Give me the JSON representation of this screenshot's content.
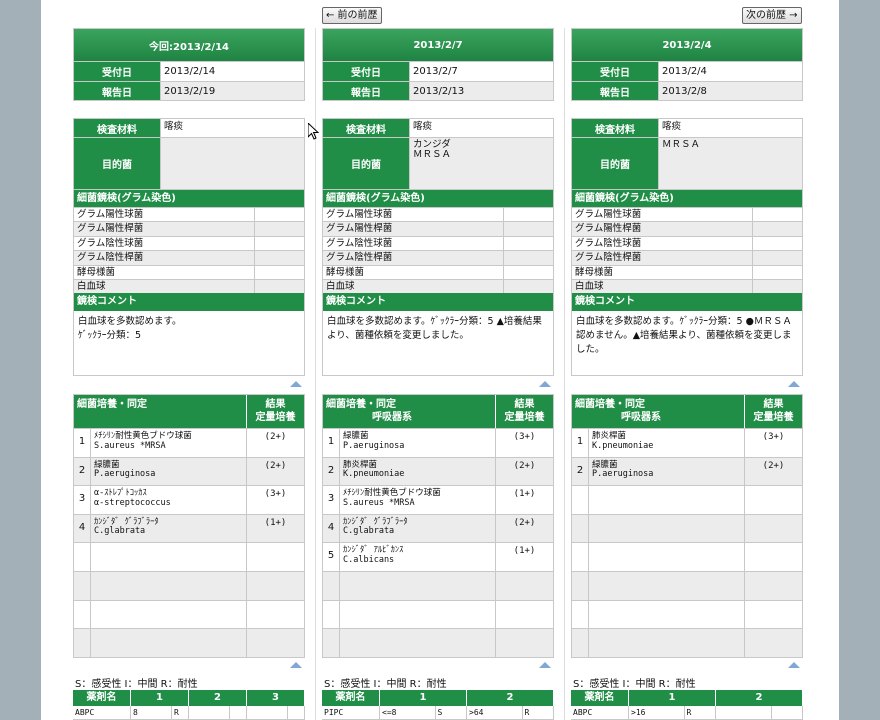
{
  "nav": {
    "prev_label": "← 前の前歴",
    "next_label": "次の前歴 →"
  },
  "labels": {
    "reception": "受付日",
    "report": "報告日",
    "material": "検査材料",
    "target": "目的菌",
    "gram_title": "細菌鏡検(グラム染色)",
    "gram_rows": [
      "グラム陽性球菌",
      "グラム陽性桿菌",
      "グラム陰性球菌",
      "グラム陰性桿菌",
      "酵母様菌",
      "白血球"
    ],
    "comment_title": "鏡検コメント",
    "culture_title": "細菌培養・同定",
    "result_label": "結果",
    "quant_label": "定量培養",
    "legend": "S：感受性  I：中間  R：耐性",
    "drug_label": "薬剤名"
  },
  "columns": [
    {
      "date_header": "今回:2013/2/14",
      "reception_date": "2013/2/14",
      "report_date": "2013/2/19",
      "material": "喀痰",
      "target_organism": "",
      "comment": "白血球を多数認めます。\nｹﾞｯｸﾗｰ分類：5",
      "culture_subtitle": "",
      "organisms": [
        {
          "n": "1",
          "name": "ﾒﾁｼﾘﾝ耐性黄色ブドウ球菌",
          "sci": "S.aureus *MRSA",
          "qty": "(2+)"
        },
        {
          "n": "2",
          "name": "緑膿菌",
          "sci": "P.aeruginosa",
          "qty": "(2+)"
        },
        {
          "n": "3",
          "name": "α-ｽﾄﾚﾌﾟﾄｺｯｶｽ",
          "sci": "α-streptococcus",
          "qty": "(3+)"
        },
        {
          "n": "4",
          "name": "ｶﾝｼﾞﾀﾞ ｸﾞﾗﾌﾞﾗｰﾀ",
          "sci": "C.glabrata",
          "qty": "(1+)"
        }
      ],
      "drug_cols": [
        "1",
        "2",
        "3"
      ],
      "drugs": [
        {
          "name": "ABPC",
          "cells": [
            "8",
            "R",
            "",
            "",
            "",
            ""
          ]
        }
      ]
    },
    {
      "date_header": "2013/2/7",
      "reception_date": "2013/2/7",
      "report_date": "2013/2/13",
      "material": "喀痰",
      "target_organism": "カンジダ\nＭＲＳＡ",
      "comment": "白血球を多数認めます。ｹﾞｯｸﾗｰ分類：5 ▲培養結果より、菌種依頼を変更しました。",
      "culture_subtitle": "呼吸器系",
      "organisms": [
        {
          "n": "1",
          "name": "緑膿菌",
          "sci": "P.aeruginosa",
          "qty": "(3+)"
        },
        {
          "n": "2",
          "name": "肺炎桿菌",
          "sci": "K.pneumoniae",
          "qty": "(2+)"
        },
        {
          "n": "3",
          "name": "ﾒﾁｼﾘﾝ耐性黄色ブドウ球菌",
          "sci": "S.aureus *MRSA",
          "qty": "(1+)"
        },
        {
          "n": "4",
          "name": "ｶﾝｼﾞﾀﾞ ｸﾞﾗﾌﾞﾗｰﾀ",
          "sci": "C.glabrata",
          "qty": "(2+)"
        },
        {
          "n": "5",
          "name": "ｶﾝｼﾞﾀﾞ ｱﾙﾋﾞｶﾝｽ",
          "sci": "C.albicans",
          "qty": "(1+)"
        }
      ],
      "drug_cols": [
        "1",
        "2"
      ],
      "drugs": [
        {
          "name": "PIPC",
          "cells": [
            "<=8",
            "S",
            ">64",
            "R"
          ]
        }
      ]
    },
    {
      "date_header": "2013/2/4",
      "reception_date": "2013/2/4",
      "report_date": "2013/2/8",
      "material": "喀痰",
      "target_organism": "ＭＲＳＡ",
      "comment": "白血球を多数認めます。ｹﾞｯｸﾗｰ分類：5 ●ＭＲＳＡ認めません。▲培養結果より、菌種依頼を変更しました。",
      "culture_subtitle": "呼吸器系",
      "organisms": [
        {
          "n": "1",
          "name": "肺炎桿菌",
          "sci": "K.pneumoniae",
          "qty": "(3+)"
        },
        {
          "n": "2",
          "name": "緑膿菌",
          "sci": "P.aeruginosa",
          "qty": "(2+)"
        }
      ],
      "drug_cols": [
        "1",
        "2"
      ],
      "drugs": [
        {
          "name": "ABPC",
          "cells": [
            ">16",
            "R",
            "",
            ""
          ]
        }
      ]
    }
  ]
}
